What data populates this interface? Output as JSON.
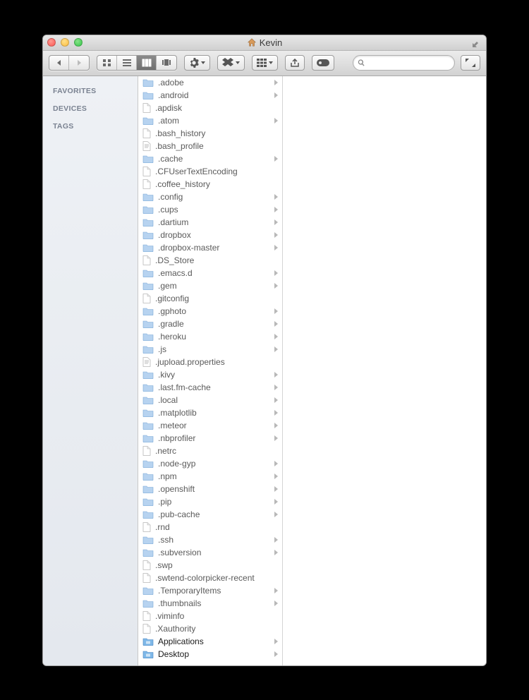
{
  "window": {
    "title": "Kevin"
  },
  "sidebar": {
    "sections": [
      {
        "label": "FAVORITES"
      },
      {
        "label": "DEVICES"
      },
      {
        "label": "TAGS"
      }
    ]
  },
  "search": {
    "placeholder": ""
  },
  "files": [
    {
      "name": ".adobe",
      "type": "folder",
      "hasChildren": true
    },
    {
      "name": ".android",
      "type": "folder",
      "hasChildren": true
    },
    {
      "name": ".apdisk",
      "type": "file",
      "hasChildren": false
    },
    {
      "name": ".atom",
      "type": "folder",
      "hasChildren": true
    },
    {
      "name": ".bash_history",
      "type": "file",
      "hasChildren": false
    },
    {
      "name": ".bash_profile",
      "type": "textfile",
      "hasChildren": false
    },
    {
      "name": ".cache",
      "type": "folder",
      "hasChildren": true
    },
    {
      "name": ".CFUserTextEncoding",
      "type": "file",
      "hasChildren": false
    },
    {
      "name": ".coffee_history",
      "type": "file",
      "hasChildren": false
    },
    {
      "name": ".config",
      "type": "folder",
      "hasChildren": true
    },
    {
      "name": ".cups",
      "type": "folder",
      "hasChildren": true
    },
    {
      "name": ".dartium",
      "type": "folder",
      "hasChildren": true
    },
    {
      "name": ".dropbox",
      "type": "folder",
      "hasChildren": true
    },
    {
      "name": ".dropbox-master",
      "type": "folder",
      "hasChildren": true
    },
    {
      "name": ".DS_Store",
      "type": "file",
      "hasChildren": false
    },
    {
      "name": ".emacs.d",
      "type": "folder",
      "hasChildren": true
    },
    {
      "name": ".gem",
      "type": "folder",
      "hasChildren": true
    },
    {
      "name": ".gitconfig",
      "type": "file",
      "hasChildren": false
    },
    {
      "name": ".gphoto",
      "type": "folder",
      "hasChildren": true
    },
    {
      "name": ".gradle",
      "type": "folder",
      "hasChildren": true
    },
    {
      "name": ".heroku",
      "type": "folder",
      "hasChildren": true
    },
    {
      "name": ".js",
      "type": "folder",
      "hasChildren": true
    },
    {
      "name": ".jupload.properties",
      "type": "textfile",
      "hasChildren": false
    },
    {
      "name": ".kivy",
      "type": "folder",
      "hasChildren": true
    },
    {
      "name": ".last.fm-cache",
      "type": "folder",
      "hasChildren": true
    },
    {
      "name": ".local",
      "type": "folder",
      "hasChildren": true
    },
    {
      "name": ".matplotlib",
      "type": "folder",
      "hasChildren": true
    },
    {
      "name": ".meteor",
      "type": "folder",
      "hasChildren": true
    },
    {
      "name": ".nbprofiler",
      "type": "folder",
      "hasChildren": true
    },
    {
      "name": ".netrc",
      "type": "file",
      "hasChildren": false
    },
    {
      "name": ".node-gyp",
      "type": "folder",
      "hasChildren": true
    },
    {
      "name": ".npm",
      "type": "folder",
      "hasChildren": true
    },
    {
      "name": ".openshift",
      "type": "folder",
      "hasChildren": true
    },
    {
      "name": ".pip",
      "type": "folder",
      "hasChildren": true
    },
    {
      "name": ".pub-cache",
      "type": "folder",
      "hasChildren": true
    },
    {
      "name": ".rnd",
      "type": "file",
      "hasChildren": false
    },
    {
      "name": ".ssh",
      "type": "folder",
      "hasChildren": true
    },
    {
      "name": ".subversion",
      "type": "folder",
      "hasChildren": true
    },
    {
      "name": ".swp",
      "type": "file",
      "hasChildren": false
    },
    {
      "name": ".swtend-colorpicker-recent",
      "type": "file",
      "hasChildren": false
    },
    {
      "name": ".TemporaryItems",
      "type": "folder",
      "hasChildren": true
    },
    {
      "name": ".thumbnails",
      "type": "folder",
      "hasChildren": true
    },
    {
      "name": ".viminfo",
      "type": "file",
      "hasChildren": false
    },
    {
      "name": ".Xauthority",
      "type": "file",
      "hasChildren": false
    },
    {
      "name": "Applications",
      "type": "appfolder",
      "hasChildren": true,
      "special": true
    },
    {
      "name": "Desktop",
      "type": "appfolder",
      "hasChildren": true,
      "special": true
    }
  ]
}
